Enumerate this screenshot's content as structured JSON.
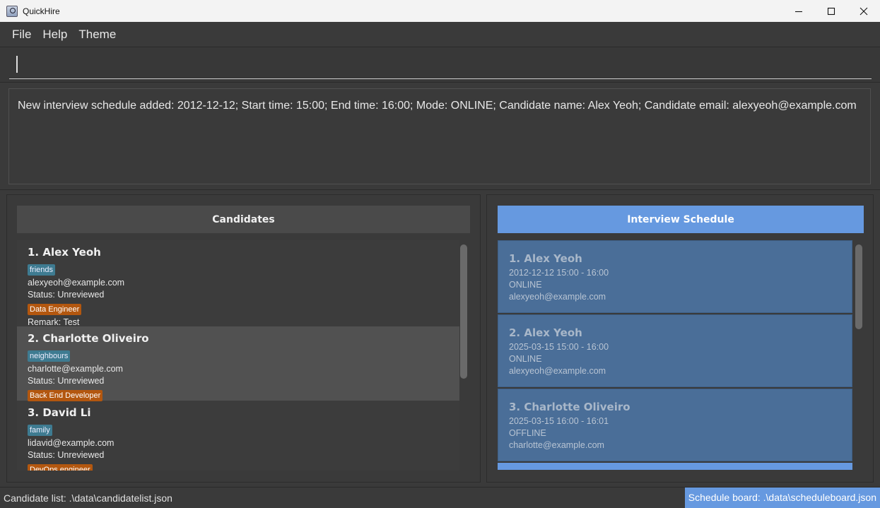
{
  "window": {
    "title": "QuickHire",
    "icon": "quickhire-app-icon"
  },
  "menu": {
    "items": [
      "File",
      "Help",
      "Theme"
    ]
  },
  "command": {
    "value": "",
    "placeholder": ""
  },
  "result": {
    "text": "New interview schedule added: 2012-12-12; Start time: 15:00; End time: 16:00; Mode: ONLINE; Candidate name: Alex Yeoh; Candidate email: alexyeoh@example.com"
  },
  "candidates": {
    "header": "Candidates",
    "items": [
      {
        "name": "1.  Alex Yeoh",
        "tag": "friends",
        "email": "alexyeoh@example.com",
        "status": "Status: Unreviewed",
        "role": "Data Engineer",
        "remark": "Remark: Test"
      },
      {
        "name": "2.  Charlotte Oliveiro",
        "tag": "neighbours",
        "email": "charlotte@example.com",
        "status": "Status: Unreviewed",
        "role": "Back End Developer"
      },
      {
        "name": "3.  David Li",
        "tag": "family",
        "email": "lidavid@example.com",
        "status": "Status: Unreviewed",
        "role": "DevOps engineer"
      }
    ]
  },
  "schedule": {
    "header": "Interview Schedule",
    "items": [
      {
        "name": "1.  Alex Yeoh",
        "time": "2012-12-12  15:00 -  16:00",
        "mode": "ONLINE",
        "email": "alexyeoh@example.com"
      },
      {
        "name": "2.  Alex Yeoh",
        "time": "2025-03-15  15:00 -  16:00",
        "mode": "ONLINE",
        "email": "alexyeoh@example.com"
      },
      {
        "name": "3.  Charlotte Oliveiro",
        "time": "2025-03-15  16:00 -  16:01",
        "mode": "OFFLINE",
        "email": "charlotte@example.com"
      }
    ]
  },
  "status": {
    "left": "Candidate list: .\\data\\candidatelist.json",
    "right": "Schedule board: .\\data\\scheduleboard.json"
  },
  "colors": {
    "accent": "#6699e0",
    "tag_blue": "#3e7b91",
    "tag_orange": "#b3570f",
    "schedule_card": "#4a6e98"
  }
}
